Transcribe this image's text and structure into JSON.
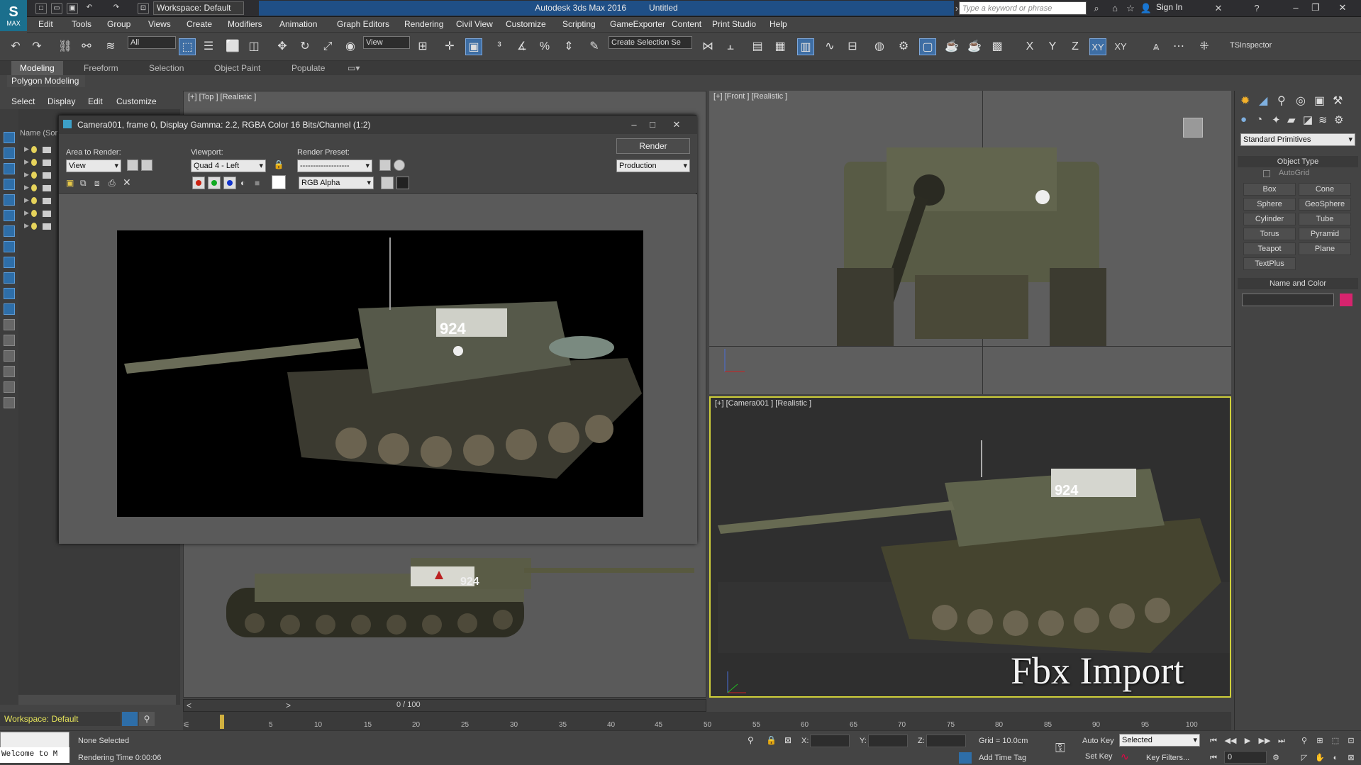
{
  "app": {
    "logo_text": "MAX",
    "workspace": "Workspace: Default",
    "title_app": "Autodesk 3ds Max 2016",
    "title_doc": "Untitled",
    "search_placeholder": "Type a keyword or phrase",
    "sign_in": "Sign In"
  },
  "menu": [
    "Edit",
    "Tools",
    "Group",
    "Views",
    "Create",
    "Modifiers",
    "Animation",
    "Graph Editors",
    "Rendering",
    "Civil View",
    "Customize",
    "Scripting",
    "GameExporter",
    "Content",
    "Print Studio",
    "Help"
  ],
  "toolbar": {
    "selection_filter": "All",
    "ref_coord": "View",
    "named_selection": "Create Selection Se",
    "axis_labels": [
      "X",
      "Y",
      "Z",
      "XY",
      "XY"
    ],
    "ts_inspector": "TSInspector"
  },
  "ribbon": {
    "tabs": [
      "Modeling",
      "Freeform",
      "Selection",
      "Object Paint",
      "Populate"
    ],
    "sub_label": "Polygon Modeling"
  },
  "scene_explorer": {
    "tabs": [
      "Select",
      "Display",
      "Edit",
      "Customize"
    ],
    "column_header": "Name (Sor"
  },
  "viewports": {
    "top": "[+] [Top ] [Realistic ]",
    "front": "[+] [Front ] [Realistic ]",
    "camera": "[+] [Camera001 ] [Realistic ]"
  },
  "render_window": {
    "title": "Camera001, frame 0, Display Gamma: 2.2, RGBA Color 16 Bits/Channel (1:2)",
    "area_label": "Area to Render:",
    "area_value": "View",
    "viewport_label": "Viewport:",
    "viewport_value": "Quad 4 - Left",
    "preset_label": "Render Preset:",
    "preset_value": "-------------------",
    "render_button": "Render",
    "production": "Production",
    "channel_value": "RGB Alpha",
    "tank_number": "924"
  },
  "timeline": {
    "frame_label": "0 / 100",
    "ticks": [
      "5",
      "10",
      "15",
      "20",
      "25",
      "30",
      "35",
      "40",
      "45",
      "50",
      "55",
      "60",
      "65",
      "70",
      "75",
      "80",
      "85",
      "90",
      "95",
      "100"
    ]
  },
  "command_panel": {
    "dropdown": "Standard Primitives",
    "object_type_header": "Object Type",
    "autogrid": "AutoGrid",
    "buttons": [
      "Box",
      "Cone",
      "Sphere",
      "GeoSphere",
      "Cylinder",
      "Tube",
      "Torus",
      "Pyramid",
      "Teapot",
      "Plane",
      "TextPlus"
    ],
    "name_color_header": "Name and Color",
    "color": "#d6246e"
  },
  "status": {
    "maxscript": "Welcome to M",
    "selection": "None Selected",
    "rendering_time": "Rendering Time  0:00:06",
    "x_label": "X:",
    "y_label": "Y:",
    "z_label": "Z:",
    "grid": "Grid = 10.0cm",
    "add_time_tag": "Add Time Tag",
    "auto_key": "Auto Key",
    "set_key": "Set Key",
    "key_mode": "Selected",
    "key_filters": "Key Filters...",
    "frame_value": "0"
  },
  "overlay_text": "Fbx Import"
}
